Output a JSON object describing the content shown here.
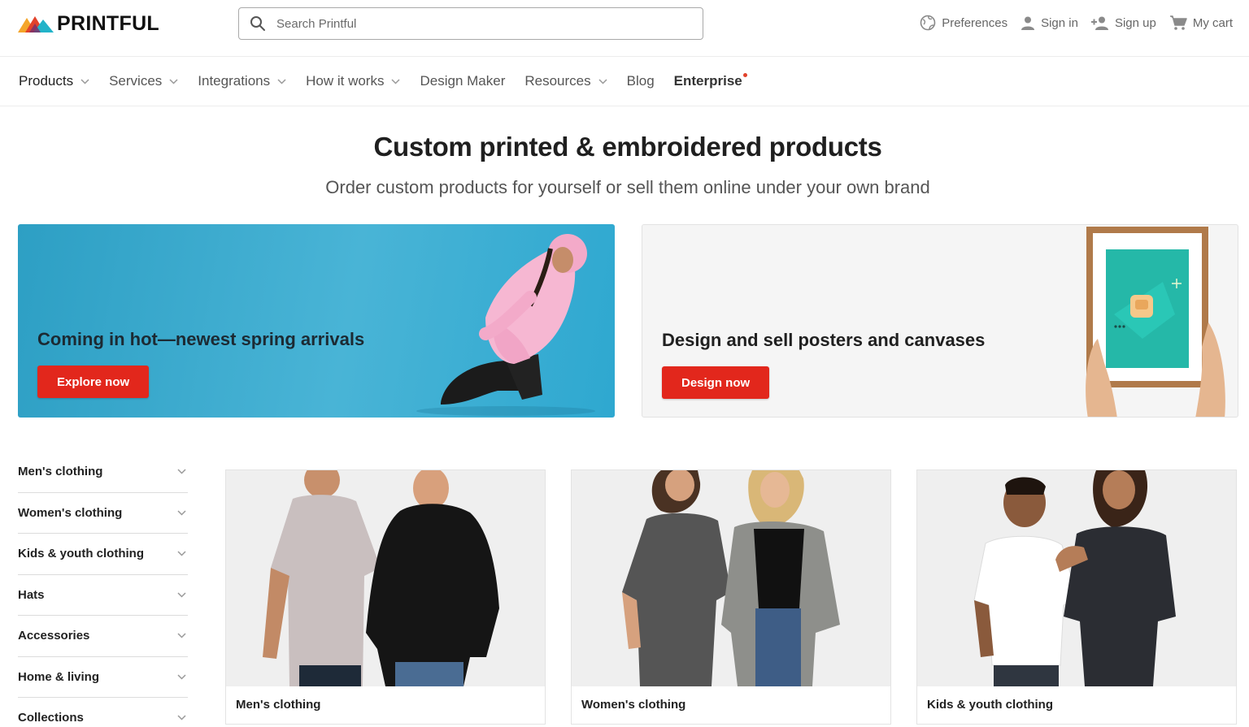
{
  "brand": {
    "name": "PRINTFUL"
  },
  "search": {
    "placeholder": "Search Printful"
  },
  "top_actions": {
    "preferences": "Preferences",
    "sign_in": "Sign in",
    "sign_up": "Sign up",
    "cart": "My cart"
  },
  "nav": {
    "products": "Products",
    "services": "Services",
    "integrations": "Integrations",
    "how_it_works": "How it works",
    "design_maker": "Design Maker",
    "resources": "Resources",
    "blog": "Blog",
    "enterprise": "Enterprise"
  },
  "hero": {
    "title": "Custom printed & embroidered products",
    "subtitle": "Order custom products for yourself or sell them online under your own brand"
  },
  "banners": [
    {
      "title": "Coming in hot—newest spring arrivals",
      "button": "Explore now"
    },
    {
      "title": "Design and sell posters and canvases",
      "button": "Design now"
    }
  ],
  "sidebar": {
    "items": [
      {
        "label": "Men's clothing"
      },
      {
        "label": "Women's clothing"
      },
      {
        "label": "Kids & youth clothing"
      },
      {
        "label": "Hats"
      },
      {
        "label": "Accessories"
      },
      {
        "label": "Home & living"
      },
      {
        "label": "Collections"
      }
    ]
  },
  "cards": [
    {
      "label": "Men's clothing"
    },
    {
      "label": "Women's clothing"
    },
    {
      "label": "Kids & youth clothing"
    }
  ],
  "colors": {
    "accent_red": "#e2271c",
    "banner_blue": "#49b4d6",
    "enterprise_dot": "#e2422b"
  }
}
